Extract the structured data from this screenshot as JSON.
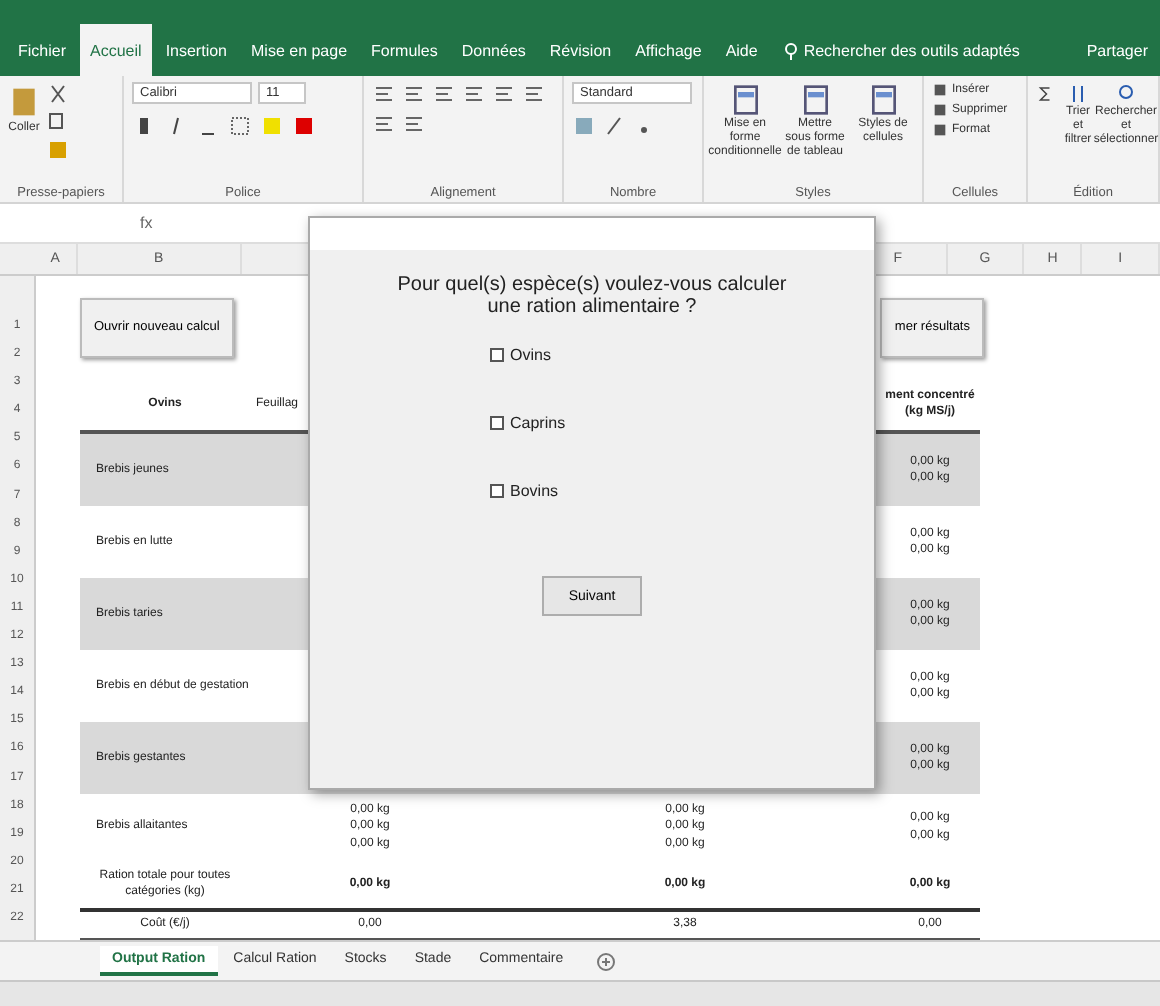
{
  "menu_tabs": [
    {
      "label": "Fichier",
      "selected": false
    },
    {
      "label": "Accueil",
      "selected": true
    },
    {
      "label": "Insertion",
      "selected": false
    },
    {
      "label": "Mise en page",
      "selected": false
    },
    {
      "label": "Formules",
      "selected": false
    },
    {
      "label": "Données",
      "selected": false
    },
    {
      "label": "Révision",
      "selected": false
    },
    {
      "label": "Affichage",
      "selected": false
    },
    {
      "label": "Aide",
      "selected": false
    }
  ],
  "tell_me": "Rechercher des outils adaptés",
  "share": "Partager",
  "ribbon": {
    "paste": "Coller",
    "font": "Calibri",
    "font_size": "11",
    "number_format": "Standard",
    "styles": [
      "Mise en forme conditionnelle",
      "Mettre sous forme de tableau",
      "Styles de cellules"
    ],
    "cells": [
      "Insérer",
      "Supprimer",
      "Format"
    ],
    "editing": [
      "Trier et filtrer",
      "Rechercher et sélectionner"
    ],
    "groups": [
      "Presse-papiers",
      "Police",
      "Alignement",
      "Nombre",
      "Styles",
      "Cellules",
      "Édition"
    ]
  },
  "formula_bar": {
    "fx": "fx"
  },
  "columns": [
    "A",
    "B",
    "F",
    "G",
    "H",
    "I"
  ],
  "row_numbers": [
    "1",
    "2",
    "3",
    "4",
    "5",
    "6",
    "7",
    "8",
    "9",
    "10",
    "11",
    "12",
    "13",
    "14",
    "15",
    "16",
    "17",
    "18",
    "19",
    "20",
    "21",
    "22"
  ],
  "sheet": {
    "buttons": [
      "Ouvrir nouveau calcul",
      "mer résultats"
    ],
    "header": [
      "Ovins",
      "Feuillag",
      "ment concentré (kg MS/j)"
    ],
    "rows": [
      {
        "label": "Brebis jeunes",
        "shaded": true,
        "c2": [],
        "c3": [],
        "c4": [
          "0,00 kg",
          "0,00 kg"
        ]
      },
      {
        "label": "Brebis en lutte",
        "shaded": false,
        "c2": [],
        "c3": [],
        "c4": [
          "0,00 kg",
          "0,00 kg"
        ]
      },
      {
        "label": "Brebis taries",
        "shaded": true,
        "c2": [],
        "c3": [],
        "c4": [
          "0,00 kg",
          "0,00 kg"
        ]
      },
      {
        "label": "Brebis en début de gestation",
        "shaded": false,
        "c2": [],
        "c3": [],
        "c4": [
          "0,00 kg",
          "0,00 kg"
        ]
      },
      {
        "label": "Brebis gestantes",
        "shaded": true,
        "c2": [],
        "c3": [],
        "c4": [
          "0,00 kg",
          "0,00 kg"
        ]
      },
      {
        "label": "Brebis allaitantes",
        "shaded": false,
        "c2": [
          "0,00 kg",
          "0,00 kg",
          "0,00 kg"
        ],
        "c3": [
          "0,00 kg",
          "0,00 kg",
          "0,00 kg"
        ],
        "c4": [
          "0,00 kg",
          "0,00 kg"
        ]
      }
    ],
    "total": {
      "label": "Ration totale pour toutes catégories (kg)",
      "values": [
        "0,00 kg",
        "0,00 kg",
        "0,00 kg"
      ]
    },
    "cost": {
      "label": "Coût (€/j)",
      "values": [
        "0,00",
        "3,38",
        "0,00"
      ]
    }
  },
  "dialog": {
    "question": "Pour quel(s) espèce(s) voulez-vous calculer une ration alimentaire ?",
    "options": [
      {
        "label": "Ovins",
        "checked": false
      },
      {
        "label": "Caprins",
        "checked": false
      },
      {
        "label": "Bovins",
        "checked": false
      }
    ],
    "button": "Suivant"
  },
  "sheet_tabs": [
    {
      "label": "Output Ration",
      "selected": true
    },
    {
      "label": "Calcul Ration",
      "selected": false
    },
    {
      "label": "Stocks",
      "selected": false
    },
    {
      "label": "Stade",
      "selected": false
    },
    {
      "label": "Commentaire",
      "selected": false
    }
  ]
}
